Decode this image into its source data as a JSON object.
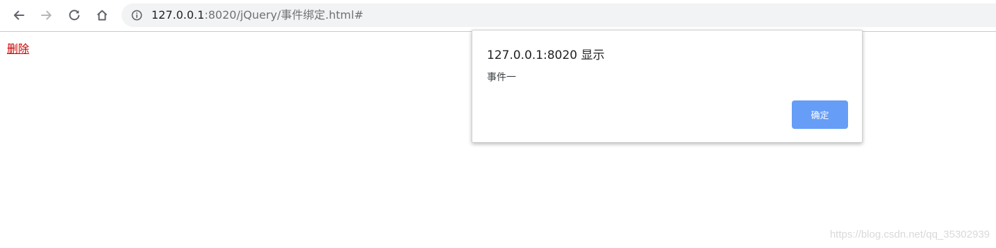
{
  "browser": {
    "icons": {
      "back": "arrow-left-icon",
      "forward": "arrow-right-icon",
      "reload": "reload-icon",
      "home": "home-icon",
      "site_info": "info-icon"
    },
    "url": {
      "host": "127.0.0.1",
      "rest": ":8020/jQuery/事件绑定.html#"
    }
  },
  "page": {
    "delete_link": "删除"
  },
  "alert": {
    "title": "127.0.0.1:8020 显示",
    "message": "事件一",
    "ok_label": "确定"
  },
  "watermark": "https://blog.csdn.net/qq_35302939",
  "colors": {
    "link": "#cc0000",
    "ok_button": "#669df6",
    "omnibox": "#f1f3f4"
  }
}
